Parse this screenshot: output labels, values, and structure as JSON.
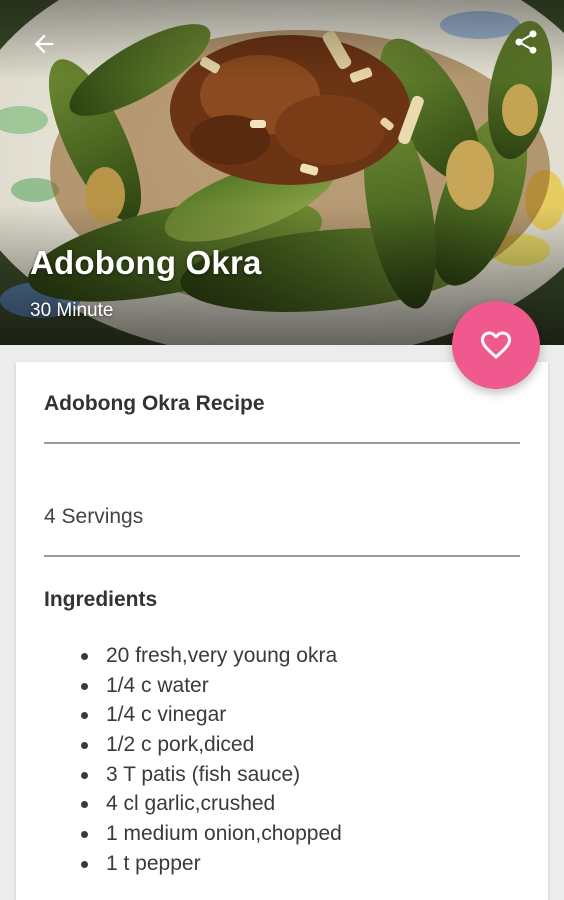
{
  "header": {
    "title": "Adobong Okra",
    "subtitle": "30 Minute",
    "back_icon": "arrow-left-icon",
    "share_icon": "share-icon"
  },
  "favorite": {
    "icon": "heart-outline-icon",
    "color": "#f0598e"
  },
  "card": {
    "recipe_title": "Adobong Okra Recipe",
    "servings": "4 Servings",
    "ingredients_heading": "Ingredients",
    "ingredients": [
      "20 fresh,very young okra",
      "1/4 c water",
      "1/4 c vinegar",
      "1/2 c pork,diced",
      "3 T patis (fish sauce)",
      "4 cl garlic,crushed",
      "1 medium onion,chopped",
      "1 t pepper"
    ]
  }
}
